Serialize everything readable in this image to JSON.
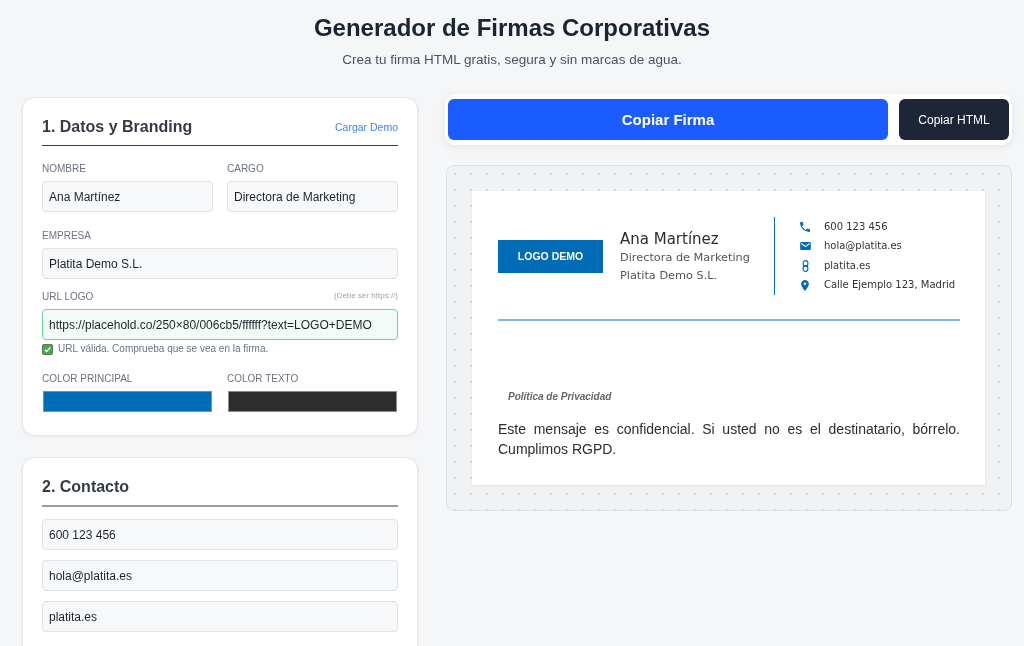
{
  "header": {
    "title": "Generador de Firmas Corporativas",
    "subtitle": "Crea tu firma HTML gratis, segura y sin marcas de agua."
  },
  "branding_panel": {
    "title": "1. Datos y Branding",
    "demo_link": "Cargar Demo",
    "field_rows": [
      [
        {
          "label": "NOMBRE",
          "value": "Ana Martínez"
        },
        {
          "label": "CARGO",
          "value": "Directora de Marketing"
        }
      ],
      [
        {
          "label": "EMPRESA",
          "value": "Platita Demo S.L."
        }
      ]
    ],
    "logo_url": {
      "label": "URL LOGO",
      "hint": "(Debe ser https://)",
      "value": "https://placehold.co/250×80/006cb5/ffffff?text=LOGO+DEMO",
      "valid": true,
      "message": "URL válida. Comprueba que se vea en la firma."
    },
    "colors": [
      {
        "label": "COLOR PRINCIPAL",
        "color": "#006cb5"
      },
      {
        "label": "COLOR TEXTO",
        "color": "#2d2d2d"
      }
    ]
  },
  "contact_panel": {
    "title": "2. Contacto",
    "fields": [
      {
        "value": "600 123 456"
      },
      {
        "value": "hola@platita.es"
      },
      {
        "value": "platita.es"
      }
    ]
  },
  "actions": [
    {
      "label": "Copiar Firma",
      "kind": "primary"
    },
    {
      "label": "Copiar HTML",
      "kind": "secondary"
    }
  ],
  "signature": {
    "logo_text": "LOGO DEMO",
    "name": "Ana Martínez",
    "job_title": "Directora de Marketing",
    "company": "Platita Demo S.L.",
    "contacts": [
      {
        "kind": "phone",
        "text": "600 123 456"
      },
      {
        "kind": "email",
        "text": "hola@platita.es"
      },
      {
        "kind": "web",
        "text": "platita.es"
      },
      {
        "kind": "address",
        "text": "Calle Ejemplo 123, Madrid"
      }
    ],
    "privacy_link": "Política de Privacidad",
    "disclaimer": "Este mensaje es confidencial. Si usted no es el destinatario, bórrelo. Cumplimos RGPD."
  }
}
